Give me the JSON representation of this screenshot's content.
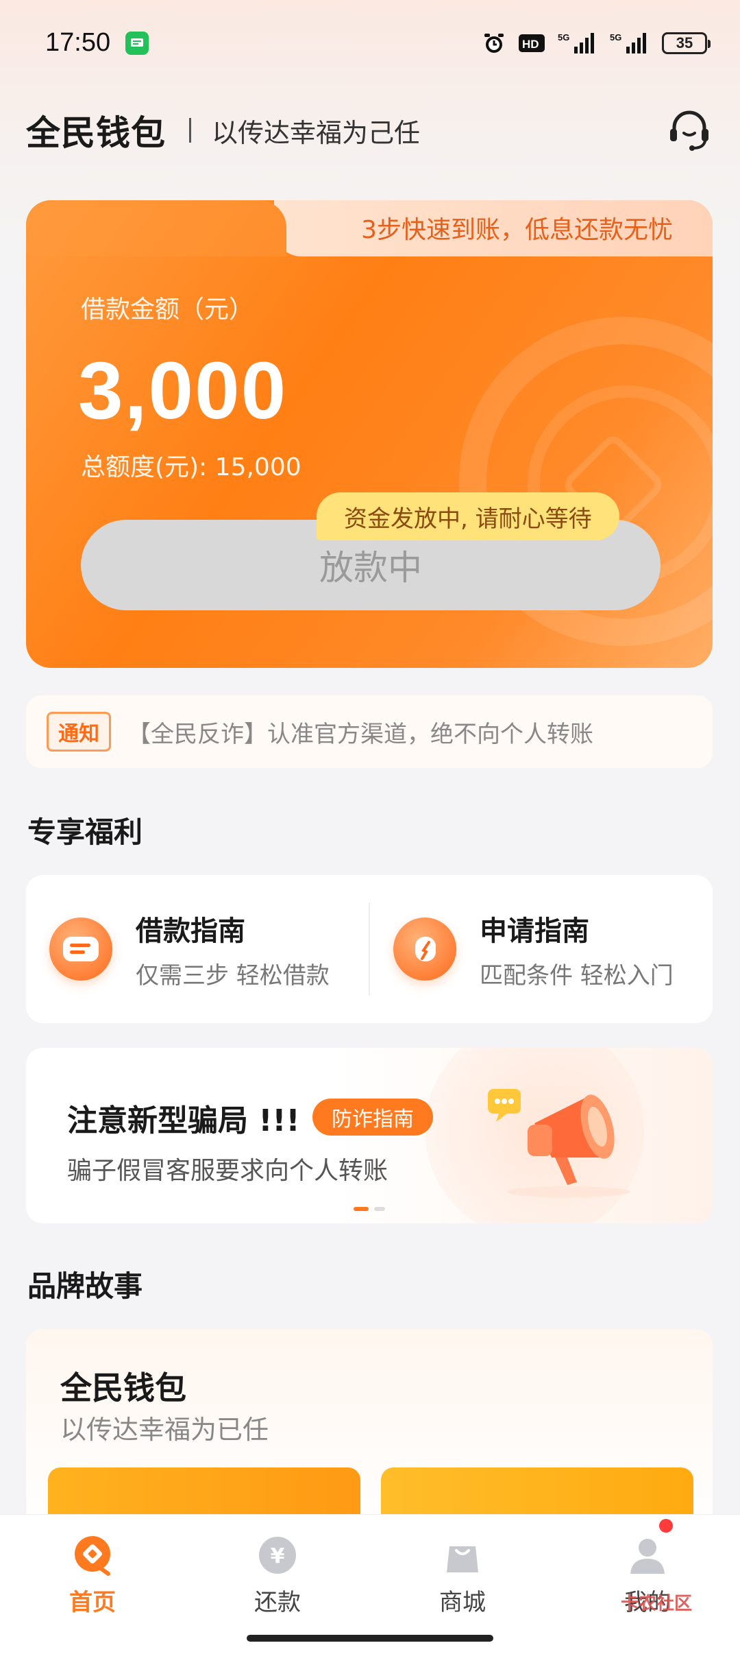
{
  "status_bar": {
    "time": "17:50",
    "battery": "35",
    "icons": [
      "messages-icon",
      "alarm-icon",
      "hd-icon",
      "signal-5g-icon",
      "signal-5g-icon"
    ]
  },
  "header": {
    "brand": "全民钱包",
    "slogan": "以传达幸福为己任",
    "customer_service_icon": "headset-icon"
  },
  "loan_card": {
    "tab_text": "3步快速到账，低息还款无忧",
    "amount_label": "借款金额（元）",
    "amount": "3,000",
    "total_quota": "总额度(元): 15,000",
    "tip": "资金发放中, 请耐心等待",
    "button_label": "放款中"
  },
  "notice": {
    "badge": "通知",
    "text": "【全民反诈】认准官方渠道，绝不向个人转账"
  },
  "benefits": {
    "title": "专享福利",
    "items": [
      {
        "title": "借款指南",
        "subtitle": "仅需三步 轻松借款",
        "icon": "document-icon"
      },
      {
        "title": "申请指南",
        "subtitle": "匹配条件 轻松入门",
        "icon": "compass-icon"
      }
    ]
  },
  "banner": {
    "title": "注意新型骗局 !!!",
    "tag": "防诈指南",
    "subtitle": "骗子假冒客服要求向个人转账",
    "icon": "megaphone-icon"
  },
  "brand_story": {
    "section_title": "品牌故事",
    "title": "全民钱包",
    "subtitle": "以传达幸福为已任"
  },
  "bottom_nav": {
    "items": [
      {
        "label": "首页",
        "icon": "home-icon",
        "active": true
      },
      {
        "label": "还款",
        "icon": "yuan-icon",
        "active": false
      },
      {
        "label": "商城",
        "icon": "shopping-bag-icon",
        "active": false
      },
      {
        "label": "我的",
        "icon": "user-icon",
        "active": false
      }
    ]
  },
  "watermark": "卡农社区",
  "colors": {
    "accent": "#ff7a1f",
    "card_orange": "#ff7f14",
    "tip_yellow": "#ffe27a"
  }
}
